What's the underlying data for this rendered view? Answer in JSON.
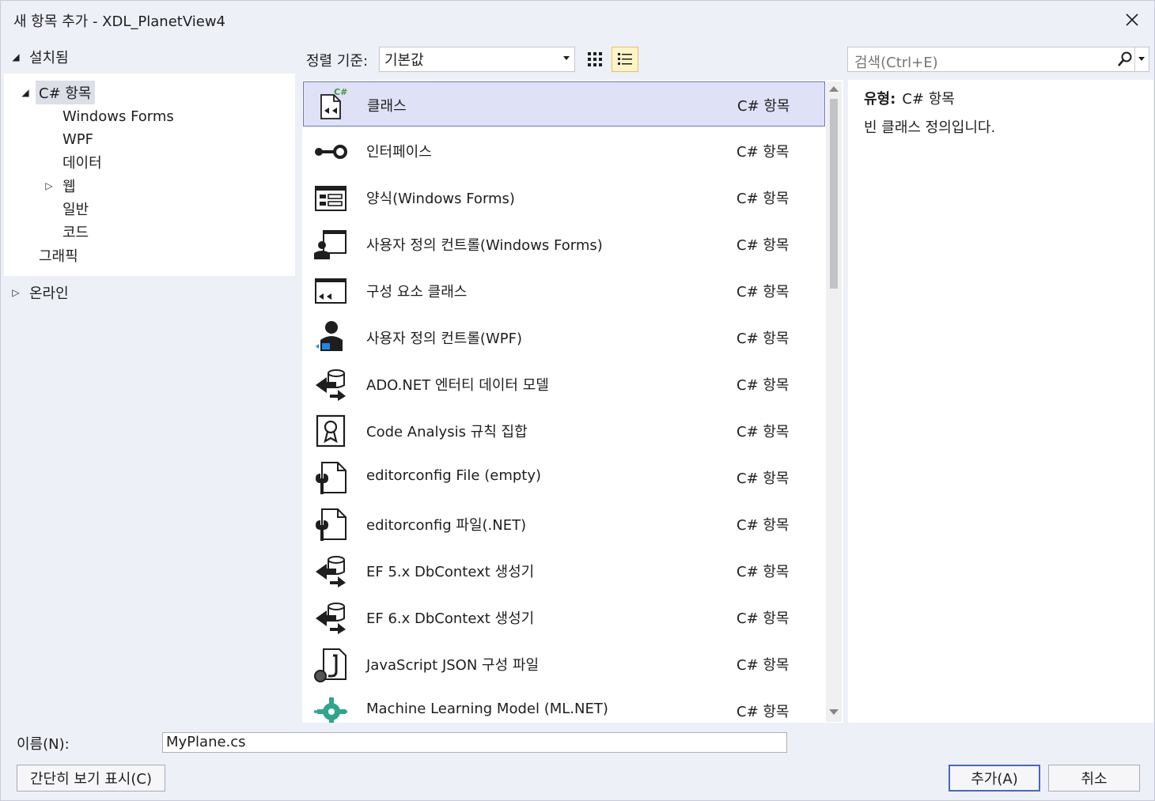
{
  "window": {
    "title": "새 항목 추가 - XDL_PlanetView4"
  },
  "left": {
    "installed_label": "설치됨",
    "tree": [
      {
        "label": "C# 항목",
        "selected": true
      },
      {
        "label": "Windows Forms"
      },
      {
        "label": "WPF"
      },
      {
        "label": "데이터"
      },
      {
        "label": "웹"
      },
      {
        "label": "일반"
      },
      {
        "label": "코드"
      },
      {
        "label": "그래픽"
      }
    ],
    "online_label": "온라인"
  },
  "toolbar": {
    "sort_label": "정렬 기준:",
    "sort_value": "기본값",
    "search_placeholder": "검색(Ctrl+E)"
  },
  "templates": [
    {
      "name": "클래스",
      "type": "C# 항목",
      "icon": "class-icon",
      "selected": true
    },
    {
      "name": "인터페이스",
      "type": "C# 항목",
      "icon": "interface-icon"
    },
    {
      "name": "양식(Windows Forms)",
      "type": "C# 항목",
      "icon": "form-icon"
    },
    {
      "name": "사용자 정의 컨트롤(Windows Forms)",
      "type": "C# 항목",
      "icon": "user-control-icon"
    },
    {
      "name": "구성 요소 클래스",
      "type": "C# 항목",
      "icon": "component-class-icon"
    },
    {
      "name": "사용자 정의 컨트롤(WPF)",
      "type": "C# 항목",
      "icon": "wpf-user-control-icon"
    },
    {
      "name": "ADO.NET 엔터티 데이터 모델",
      "type": "C# 항목",
      "icon": "entity-model-icon"
    },
    {
      "name": "Code Analysis 규칙 집합",
      "type": "C# 항목",
      "icon": "ruleset-icon"
    },
    {
      "name": "editorconfig File (empty)",
      "type": "C# 항목",
      "icon": "editorconfig-icon"
    },
    {
      "name": "editorconfig 파일(.NET)",
      "type": "C# 항목",
      "icon": "editorconfig-icon"
    },
    {
      "name": "EF 5.x DbContext 생성기",
      "type": "C# 항목",
      "icon": "dbcontext-generator-icon"
    },
    {
      "name": "EF 6.x DbContext 생성기",
      "type": "C# 항목",
      "icon": "dbcontext-generator-icon"
    },
    {
      "name": "JavaScript JSON 구성 파일",
      "type": "C# 항목",
      "icon": "json-config-icon"
    },
    {
      "name": "Machine Learning Model (ML.NET)",
      "type": "C# 항목",
      "icon": "ml-model-icon"
    }
  ],
  "detail": {
    "type_label": "유형:",
    "type_value": "C# 항목",
    "description": "빈 클래스 정의입니다."
  },
  "bottom": {
    "name_label": "이름(N):",
    "name_value": "MyPlane.cs",
    "compact_view_label": "간단히 보기 표시(C)",
    "add_label": "추가(A)",
    "cancel_label": "취소"
  },
  "colors": {
    "selection_fill": "#dfe1f7",
    "selection_border": "#6b78c8",
    "primary_button_border": "#4468c4",
    "ml_icon": "#2fa68c",
    "wpf_accent": "#1e88e5"
  }
}
